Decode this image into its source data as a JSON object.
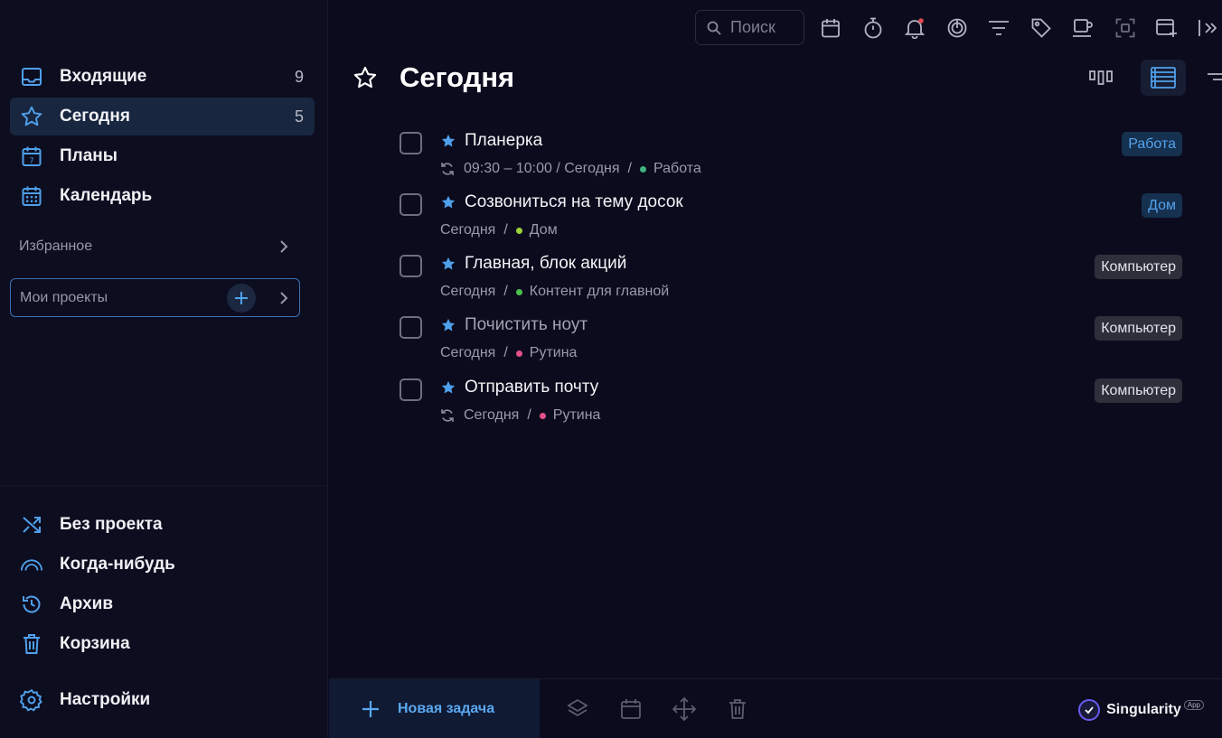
{
  "sidebar": {
    "nav": [
      {
        "label": "Входящие",
        "count": "9",
        "icon": "inbox-icon"
      },
      {
        "label": "Сегодня",
        "count": "5",
        "icon": "star-icon"
      },
      {
        "label": "Планы",
        "count": "",
        "icon": "calendar-day-icon"
      },
      {
        "label": "Календарь",
        "count": "",
        "icon": "calendar-grid-icon"
      }
    ],
    "favorites_label": "Избранное",
    "projects_label": "Мои проекты",
    "bottom_nav": [
      {
        "label": "Без проекта",
        "icon": "shuffle-icon"
      },
      {
        "label": "Когда-нибудь",
        "icon": "rainbow-icon"
      },
      {
        "label": "Архив",
        "icon": "history-icon"
      },
      {
        "label": "Корзина",
        "icon": "trash-icon"
      }
    ],
    "settings_label": "Настройки"
  },
  "toolbar": {
    "search_placeholder": "Поиск"
  },
  "header": {
    "title": "Сегодня"
  },
  "tasks": [
    {
      "title": "Планерка",
      "repeat": true,
      "meta_date": "09:30 – 10:00 / Сегодня",
      "project": "Работа",
      "dot_color": "#3fb27f",
      "tag": "Работа",
      "tag_style": "blue",
      "dim": false
    },
    {
      "title": "Созвониться на тему досок",
      "repeat": false,
      "meta_date": "Сегодня",
      "project": "Дом",
      "dot_color": "#9bd13a",
      "tag": "Дом",
      "tag_style": "blue",
      "dim": false
    },
    {
      "title": "Главная, блок акций",
      "repeat": false,
      "meta_date": "Сегодня",
      "project": "Контент для главной",
      "dot_color": "#4cc14f",
      "tag": "Компьютер",
      "tag_style": "gray",
      "dim": false
    },
    {
      "title": "Почистить ноут",
      "repeat": false,
      "meta_date": "Сегодня",
      "project": "Рутина",
      "dot_color": "#e2508a",
      "tag": "Компьютер",
      "tag_style": "gray",
      "dim": true
    },
    {
      "title": "Отправить почту",
      "repeat": true,
      "meta_date": "Сегодня",
      "project": "Рутина",
      "dot_color": "#e2508a",
      "tag": "Компьютер",
      "tag_style": "gray",
      "dim": false
    }
  ],
  "bottom_bar": {
    "new_task_label": "Новая задача",
    "brand_name": "Singularity",
    "brand_sup": "App"
  },
  "colors": {
    "accent": "#4fa0ea",
    "background": "#0b0b1d",
    "notification_dot": "#e5484d"
  }
}
